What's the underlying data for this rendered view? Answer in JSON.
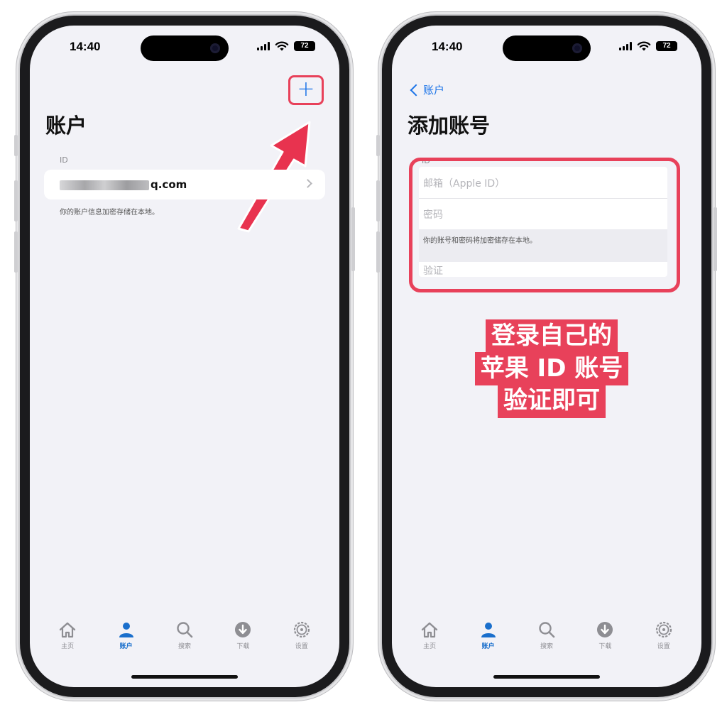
{
  "status_bar": {
    "time": "14:40",
    "battery": "72"
  },
  "left_screen": {
    "title": "账户",
    "section_label": "ID",
    "account_email_suffix": "q.com",
    "footnote": "你的账户信息加密存储在本地。"
  },
  "right_screen": {
    "back_label": "账户",
    "title": "添加账号",
    "section_label": "ID",
    "email_placeholder": "邮箱（Apple ID）",
    "password_placeholder": "密码",
    "hint": "你的账号和密码将加密储存在本地。",
    "verify_placeholder": "验证",
    "caption_lines": [
      "登录自己的",
      "苹果 ID 账号",
      "验证即可"
    ]
  },
  "tabbar": {
    "items": [
      {
        "label": "主页",
        "icon": "home-icon"
      },
      {
        "label": "账户",
        "icon": "person-icon"
      },
      {
        "label": "搜索",
        "icon": "search-icon"
      },
      {
        "label": "下载",
        "icon": "download-icon"
      },
      {
        "label": "设置",
        "icon": "settings-icon"
      }
    ],
    "active_index": 1
  },
  "colors": {
    "accent": "#1a73e8",
    "highlight": "#e8415a",
    "background": "#f2f2f7"
  }
}
